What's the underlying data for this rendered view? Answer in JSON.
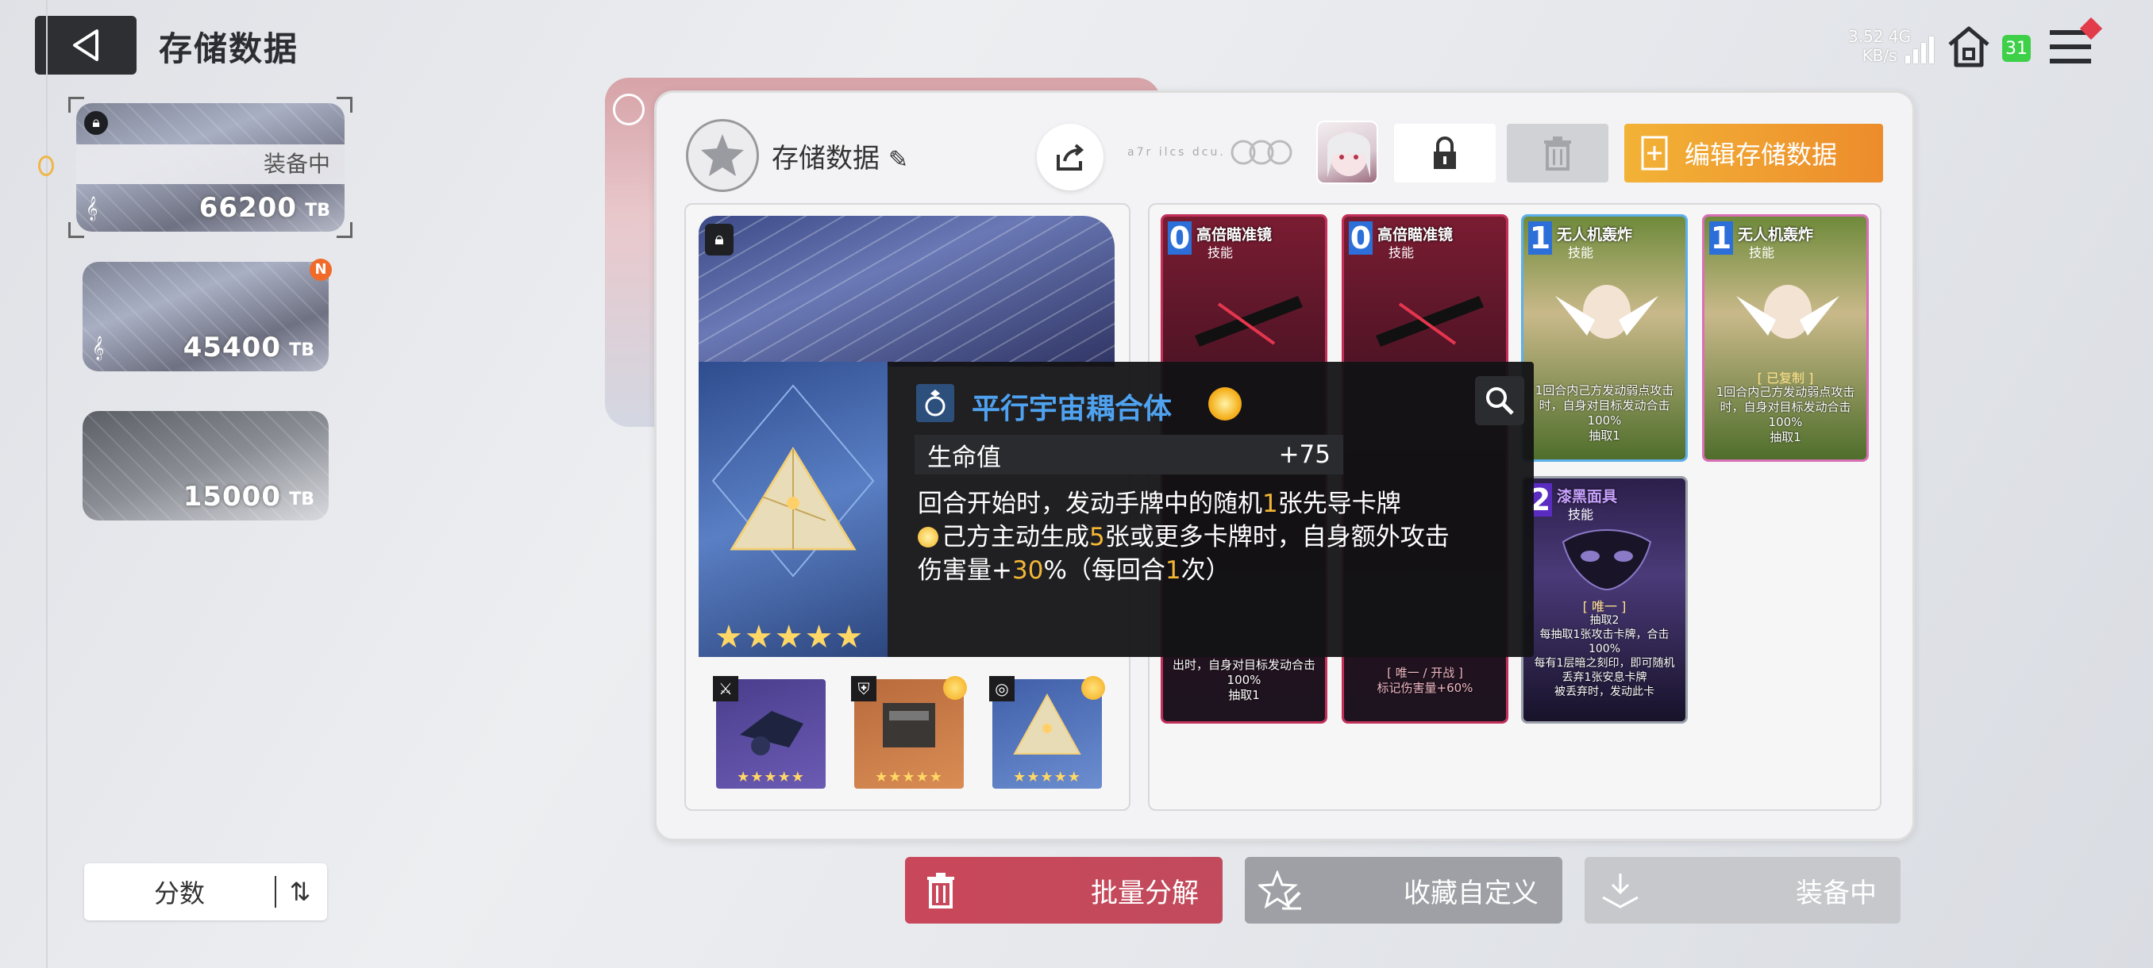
{
  "header": {
    "title": "存储数据"
  },
  "status_bar": {
    "net_speed": "3.52 4G",
    "net_unit": "KB/s",
    "battery": "31"
  },
  "data_slots": [
    {
      "value": "66200",
      "unit": "TB",
      "status": "装备中",
      "selected": true,
      "locked": true
    },
    {
      "value": "45400",
      "unit": "TB",
      "badge": "N"
    },
    {
      "value": "15000",
      "unit": "TB"
    }
  ],
  "sort": {
    "label": "分数"
  },
  "panel": {
    "title": "存储数据",
    "edit_label": "编辑存储数据",
    "faint_text": "a7r ilcs dcu."
  },
  "equipment": [
    {
      "type": "weapon",
      "stars": "★★★★★"
    },
    {
      "type": "armor",
      "stars": "★★★★★"
    },
    {
      "type": "ring",
      "stars": "★★★★★"
    }
  ],
  "cards": [
    {
      "cost": "0",
      "name": "高倍瞄准镜",
      "tag": "技能",
      "desc": "出时，自身对目标发动合击100%\n抽取1"
    },
    {
      "cost": "0",
      "name": "高倍瞄准镜",
      "tag": "技能",
      "desc": "[ 唯一 / 开战 ]\n标记伤害量+60%"
    },
    {
      "cost": "1",
      "name": "无人机轰炸",
      "tag": "技能",
      "desc": "1回合内己方发动弱点攻击时，自身对目标发动合击100%\n抽取1"
    },
    {
      "cost": "1",
      "name": "无人机轰炸",
      "tag": "技能",
      "status": "[ 已复制 ]",
      "desc": "1回合内己方发动弱点攻击时，自身对目标发动合击100%\n抽取1"
    },
    {
      "cost": "2",
      "name": "漆黑面具",
      "tag": "技能",
      "status": "[ 唯一 ]",
      "desc": "抽取2\n每抽取1张攻击卡牌，合击100%\n每有1层暗之刻印，即可随机丢弃1张安息卡牌\n被丢弃时，发动此卡"
    }
  ],
  "tooltip": {
    "title": "平行宇宙耦合体",
    "stat_label": "生命值",
    "stat_value": "+75",
    "desc_line1_a": "回合开始时，发动手牌中的随机",
    "desc_line1_num": "1",
    "desc_line1_b": "张先导卡牌",
    "desc_line2_a": "己方主动生成",
    "desc_line2_num": "5",
    "desc_line2_b": "张或更多卡牌时，自身额外攻击",
    "desc_line3_a": "伤害量+",
    "desc_line3_num": "30",
    "desc_line3_b": "%（每回合",
    "desc_line3_num2": "1",
    "desc_line3_c": "次）",
    "stars": "★★★★★"
  },
  "bottom_buttons": {
    "decompose": "批量分解",
    "favorite": "收藏自定义",
    "equip": "装备中"
  },
  "colors": {
    "accent_orange": "#ED8C2C",
    "decompose_red": "#C9475A",
    "title_blue": "#4FA2F0",
    "highlight_gold": "#F5B736"
  }
}
